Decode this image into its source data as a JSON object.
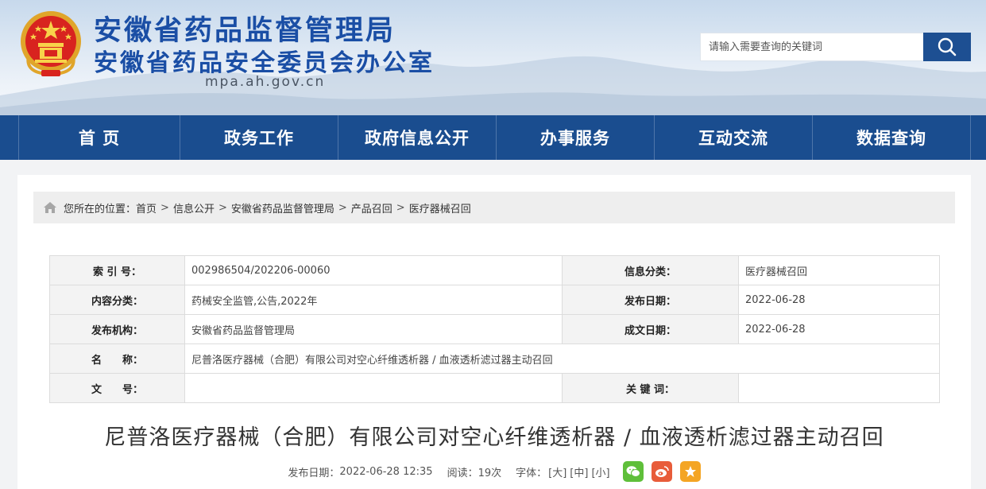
{
  "header": {
    "title_line1": "安徽省药品监督管理局",
    "title_line2": "安徽省药品安全委员会办公室",
    "domain": "mpa.ah.gov.cn",
    "search_placeholder": "请输入需要查询的关键词"
  },
  "nav": {
    "items": [
      {
        "label": "首 页"
      },
      {
        "label": "政务工作"
      },
      {
        "label": "政府信息公开"
      },
      {
        "label": "办事服务"
      },
      {
        "label": "互动交流"
      },
      {
        "label": "数据查询"
      }
    ]
  },
  "breadcrumb": {
    "prefix": "您所在的位置：",
    "items": [
      "首页",
      "信息公开",
      "安徽省药品监督管理局",
      "产品召回",
      "医疗器械召回"
    ],
    "separator": ">"
  },
  "info": {
    "index_label": "索 引 号：",
    "index_value": "002986504/202206-00060",
    "category_label": "信息分类：",
    "category_value": "医疗器械召回",
    "content_type_label": "内容分类：",
    "content_type_value": "药械安全监管,公告,2022年",
    "publish_date_label": "发布日期：",
    "publish_date_value": "2022-06-28",
    "publisher_label": "发布机构：",
    "publisher_value": "安徽省药品监督管理局",
    "created_date_label": "成文日期：",
    "created_date_value": "2022-06-28",
    "name_label": "名　　称：",
    "name_value": "尼普洛医疗器械（合肥）有限公司对空心纤维透析器 / 血液透析滤过器主动召回",
    "doc_no_label": "文　　号：",
    "doc_no_value": "",
    "keywords_label": "关 键 词：",
    "keywords_value": ""
  },
  "article": {
    "title": "尼普洛医疗器械（合肥）有限公司对空心纤维透析器 / 血液透析滤过器主动召回",
    "publish_prefix": "发布日期：",
    "publish_datetime": "2022-06-28 12:35",
    "reads_prefix": "阅读：",
    "reads_value": "19次",
    "font_prefix": "字体：",
    "font_large": "[大]",
    "font_medium": "[中]",
    "font_small": "[小]"
  },
  "icons": {
    "search": "search-icon",
    "home": "home-icon",
    "wechat": "wechat-icon",
    "weibo": "weibo-icon",
    "favorite": "star-icon"
  },
  "colors": {
    "brand_blue": "#1a4ea5",
    "nav_bg": "#1a4d8f",
    "search_btn": "#1d4f92",
    "wechat": "#5fbf3a",
    "weibo": "#e85c3a",
    "favorite": "#f4a524"
  }
}
